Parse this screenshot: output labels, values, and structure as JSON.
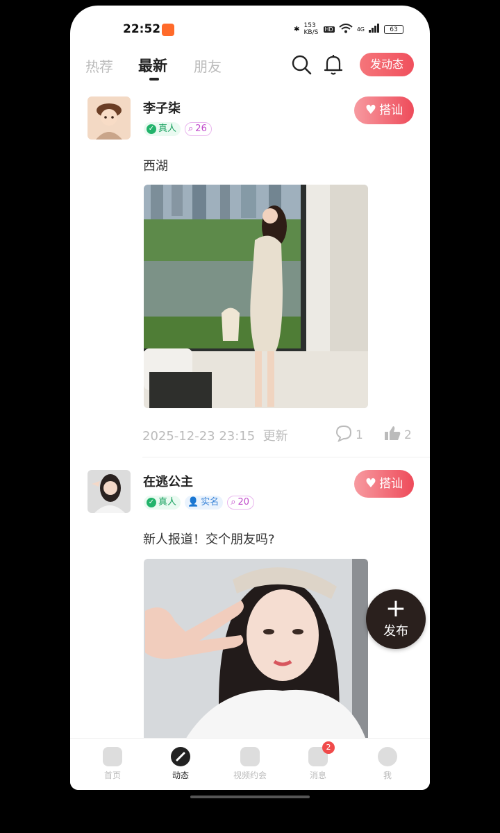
{
  "status": {
    "time": "22:52",
    "net_speed": "153 KB/S",
    "hd": "HD",
    "signal": "4G",
    "battery": "63"
  },
  "tabs": [
    {
      "label": "热荐"
    },
    {
      "label": "最新"
    },
    {
      "label": "朋友"
    }
  ],
  "post_button": "发动态",
  "posts": [
    {
      "user": "李子柒",
      "real": "真人",
      "score": "26",
      "greet": "搭讪",
      "text": "西湖",
      "time": "2025-12-23 23:15",
      "updated": "更新",
      "comments": "1",
      "likes": "2"
    },
    {
      "user": "在逃公主",
      "real": "真人",
      "realname": "实名",
      "score": "20",
      "greet": "搭讪",
      "text": "新人报道！交个朋友吗?"
    }
  ],
  "fab": {
    "label": "发布"
  },
  "tabbar": [
    {
      "label": "首页"
    },
    {
      "label": "动态"
    },
    {
      "label": "视频约会"
    },
    {
      "label": "消息",
      "badge": "2"
    },
    {
      "label": "我"
    }
  ]
}
